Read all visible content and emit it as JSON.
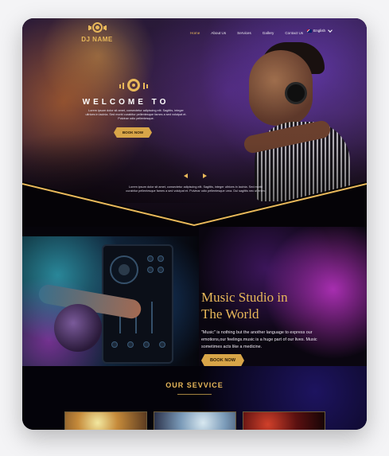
{
  "brand": {
    "name": "DJ NAME",
    "gold": "#e8b85a",
    "logo_icon": "vinyl-disc-icon"
  },
  "nav": {
    "items": [
      {
        "label": "Home",
        "active": true
      },
      {
        "label": "About Us",
        "active": false
      },
      {
        "label": "Services",
        "active": false
      },
      {
        "label": "Gallery",
        "active": false
      },
      {
        "label": "Contact Us",
        "active": false
      }
    ],
    "language": {
      "label": "English",
      "icon": "uk-flag-icon"
    }
  },
  "hero": {
    "title": "WELCOME TO",
    "text": "Lorem ipsum dolor sit amet, consectetur adipiscing elit. Sagittis, integer ultrices in lacinia. Sed morbi curabitur pellentesque fames a sed volutpat et. Pulvinar odio pellentesque.",
    "button": "BOOK NOW",
    "bottom_text": "Lorem ipsum dolor sit amet, consectetur adipiscing elit. Sagittis, integer ultrices in lacinia. Sed morbi curabitur pellentesque fames a sed volutpat et. Pulvinar odio pellentesque urna. Dui sagittis nec ut enim."
  },
  "studio": {
    "title_line1": "Music Studio in",
    "title_line2": "The World",
    "description": "\"Music\" is nothing but the another language to express our emotions,our feelings.music is a huge part of our lives. Music sometimes acts like a medicine.",
    "button": "BOOK NOW"
  },
  "services": {
    "title": "OUR SEVVICE"
  }
}
